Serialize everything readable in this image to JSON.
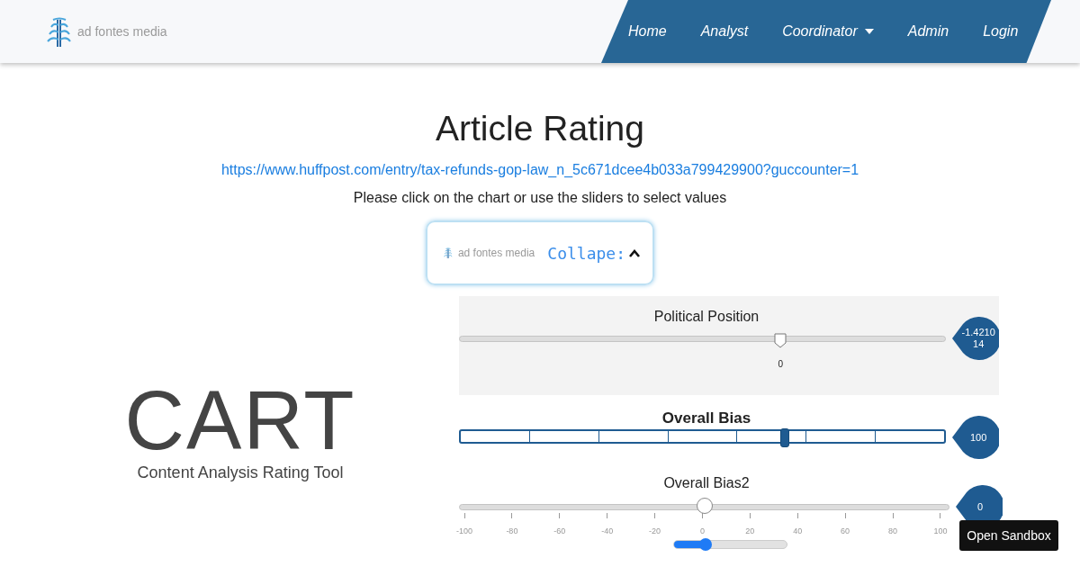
{
  "nav": {
    "logo_text": "ad fontes media",
    "links": [
      {
        "label": "Home",
        "dropdown": false
      },
      {
        "label": "Analyst",
        "dropdown": false
      },
      {
        "label": "Coordinator",
        "dropdown": true
      },
      {
        "label": "Admin",
        "dropdown": false
      },
      {
        "label": "Login",
        "dropdown": false
      }
    ]
  },
  "page": {
    "title": "Article Rating",
    "url": "https://www.huffpost.com/entry/tax-refunds-gop-law_n_5c671dcee4b033a799429900?guccounter=1",
    "instruction": "Please click on the chart or use the sliders to select values"
  },
  "logo_card": {
    "logo_text": "ad fontes media",
    "toggle": "Collape:",
    "expanded": true
  },
  "brand": {
    "name": "CART",
    "tagline": "Content Analysis Rating Tool"
  },
  "sliders": [
    {
      "kind": "shield",
      "title": "Political Position",
      "level": 0.66,
      "thumb_label": "0",
      "reading_lines": [
        "-1.4210",
        "14"
      ]
    },
    {
      "kind": "segmented",
      "title": "Overall Bias",
      "level": 0.67,
      "reading_lines": [
        "100"
      ]
    },
    {
      "kind": "ticked",
      "title": "Overall Bias2",
      "level": 0.5,
      "reading_lines": [
        "0"
      ],
      "ticks": [
        "-100",
        "-80",
        "-60",
        "-40",
        "-20",
        "0",
        "20",
        "40",
        "60",
        "80",
        "100"
      ]
    }
  ],
  "mini_slider": {
    "level": 0.28
  },
  "sandbox_button": "Open Sandbox"
}
